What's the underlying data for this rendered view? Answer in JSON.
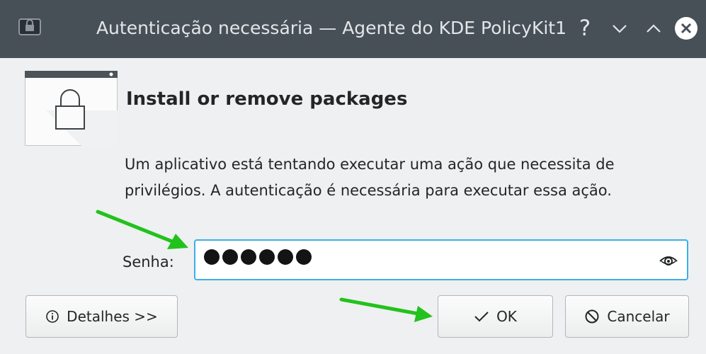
{
  "window": {
    "title": "Autenticação necessária — Agente do KDE PolicyKit1",
    "help_glyph": "?",
    "icons": [
      "app-icon",
      "help-icon",
      "minimize-icon",
      "maximize-icon",
      "close-icon"
    ]
  },
  "dialog": {
    "heading": "Install or remove packages",
    "description": "Um aplicativo está tentando executar uma ação que necessita de privilégios. A autenticação é necessária para executar essa ação.",
    "icon": "lock-window-icon"
  },
  "password": {
    "label": "Senha:",
    "masked_length": 6,
    "reveal_icon": "eye-icon"
  },
  "buttons": {
    "details": "Detalhes >>",
    "ok": "OK",
    "cancel": "Cancelar"
  },
  "colors": {
    "titlebar": "#475057",
    "focus": "#3daee9",
    "annotation_arrow": "#22c21c"
  }
}
